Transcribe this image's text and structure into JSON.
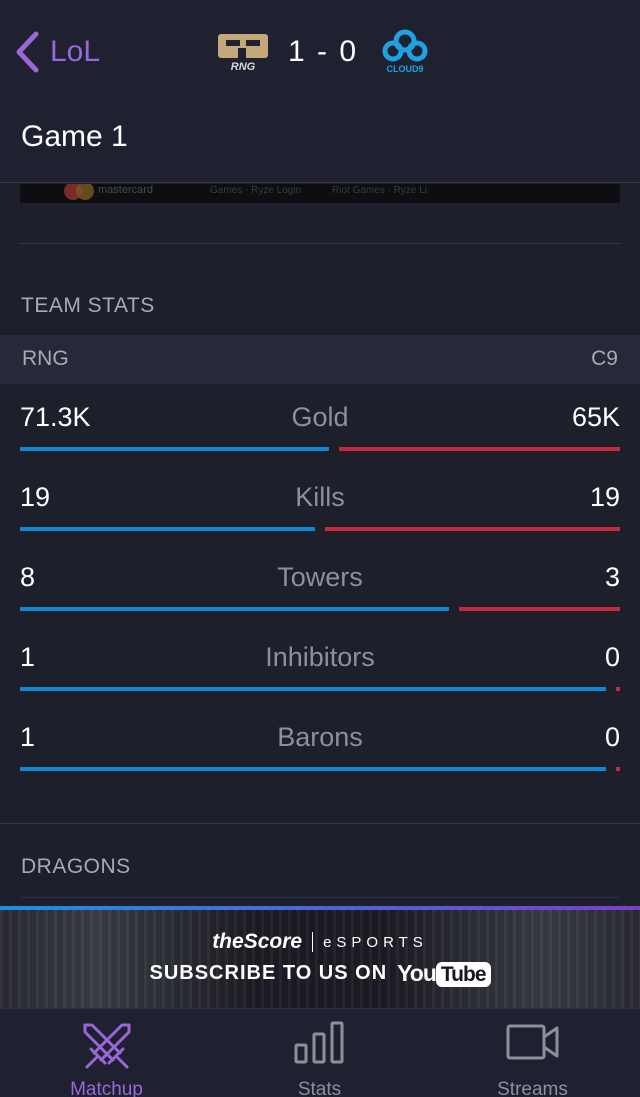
{
  "header": {
    "back_label": "LoL",
    "score": "1 - 0",
    "team_left_logo_text": "RNG",
    "team_right_logo_text": "CLOUD9",
    "title": "Game 1"
  },
  "ad": {
    "brand": "mastercard",
    "snippet1": "Games - Ryze Login",
    "snippet2": "Riot Games - Ryze Li"
  },
  "team_stats": {
    "heading": "TEAM STATS",
    "team_left": "RNG",
    "team_right": "C9",
    "rows": [
      {
        "label": "Gold",
        "left": "71.3K",
        "right": "65K",
        "left_share": 0.523
      },
      {
        "label": "Kills",
        "left": "19",
        "right": "19",
        "left_share": 0.5
      },
      {
        "label": "Towers",
        "left": "8",
        "right": "3",
        "left_share": 0.727
      },
      {
        "label": "Inhibitors",
        "left": "1",
        "right": "0",
        "left_share": 1.0
      },
      {
        "label": "Barons",
        "left": "1",
        "right": "0",
        "left_share": 1.0
      }
    ],
    "colors": {
      "left": "#0c89d6",
      "right": "#c7283e"
    }
  },
  "dragons": {
    "heading": "DRAGONS"
  },
  "banner": {
    "brand": "theScore",
    "brand_sub": "eSPORTS",
    "subscribe": "SUBSCRIBE TO US ON",
    "yt_you": "You",
    "yt_tube": "Tube"
  },
  "tabs": [
    {
      "label": "Matchup",
      "icon": "crossed-swords-icon",
      "active": true
    },
    {
      "label": "Stats",
      "icon": "bar-chart-icon",
      "active": false
    },
    {
      "label": "Streams",
      "icon": "video-camera-icon",
      "active": false
    }
  ],
  "accent": "#9a66d8"
}
